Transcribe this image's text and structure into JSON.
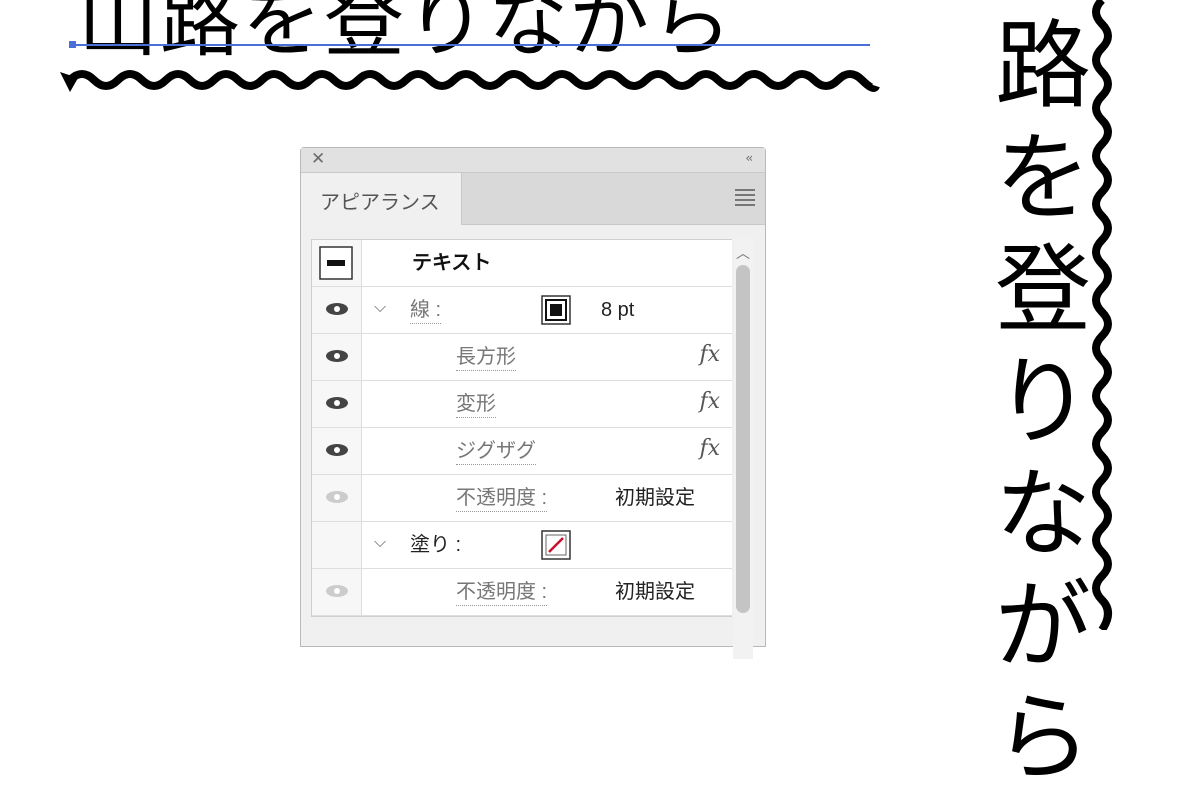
{
  "canvas": {
    "horizontal_text": "山路を登りながら",
    "vertical_text": [
      "路",
      "を",
      "登",
      "り",
      "な",
      "が",
      "ら"
    ]
  },
  "panel": {
    "tab_label": "アピアランス",
    "object_label": "テキスト",
    "stroke": {
      "label": "線 :",
      "value": "8 pt",
      "effects": [
        {
          "label": "長方形",
          "icon": "fx-icon",
          "fx": "fx"
        },
        {
          "label": "変形",
          "icon": "fx-icon",
          "fx": "fx"
        },
        {
          "label": "ジグザグ",
          "icon": "fx-icon",
          "fx": "fx"
        }
      ],
      "opacity_label": "不透明度 :",
      "opacity_value": "初期設定"
    },
    "fill": {
      "label": "塗り :",
      "opacity_label": "不透明度 :",
      "opacity_value": "初期設定"
    }
  },
  "colors": {
    "panel_bg": "#f0f0f0",
    "fill_none_slash": "#c8102e",
    "selection_line": "#4a6fd8"
  }
}
